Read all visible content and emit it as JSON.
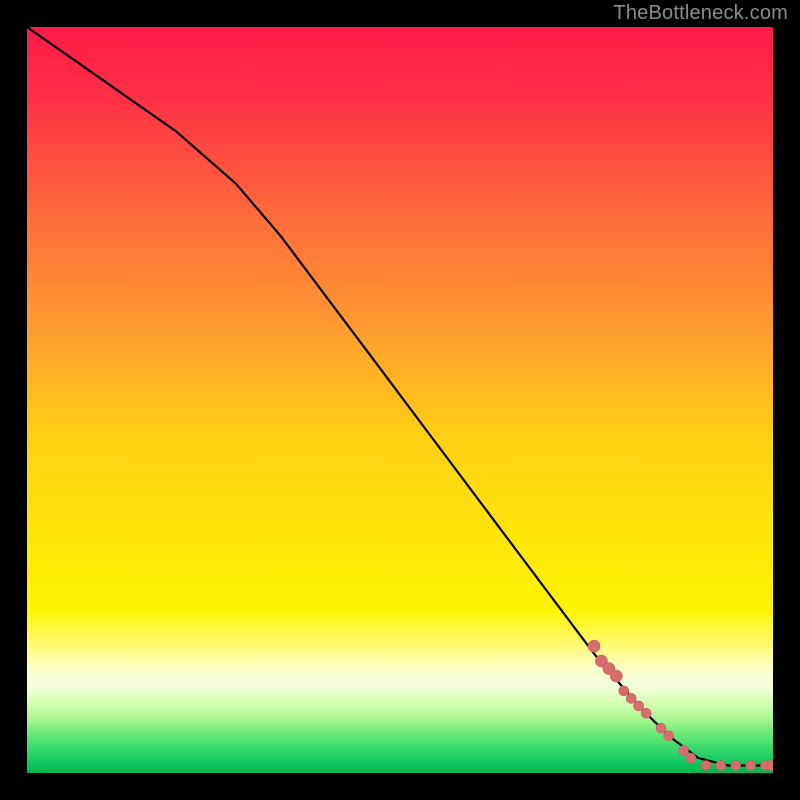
{
  "watermark": "TheBottleneck.com",
  "colors": {
    "point_fill": "#d76e6e",
    "point_stroke": "#c85b5b",
    "curve": "#000000"
  },
  "chart_data": {
    "type": "line+scatter",
    "title": "",
    "xlabel": "",
    "ylabel": "",
    "xlim": [
      0,
      100
    ],
    "ylim": [
      0,
      100
    ],
    "curve": [
      {
        "x": 0,
        "y": 100
      },
      {
        "x": 10,
        "y": 93
      },
      {
        "x": 20,
        "y": 86
      },
      {
        "x": 28,
        "y": 79
      },
      {
        "x": 34,
        "y": 72
      },
      {
        "x": 40,
        "y": 64
      },
      {
        "x": 46,
        "y": 56
      },
      {
        "x": 52,
        "y": 48
      },
      {
        "x": 58,
        "y": 40
      },
      {
        "x": 64,
        "y": 32
      },
      {
        "x": 70,
        "y": 24
      },
      {
        "x": 76,
        "y": 16
      },
      {
        "x": 82,
        "y": 9
      },
      {
        "x": 86,
        "y": 5
      },
      {
        "x": 90,
        "y": 2
      },
      {
        "x": 94,
        "y": 1
      },
      {
        "x": 98,
        "y": 1
      },
      {
        "x": 100,
        "y": 1
      }
    ],
    "points": [
      {
        "x": 76,
        "y": 17,
        "r": 6
      },
      {
        "x": 77,
        "y": 15,
        "r": 6
      },
      {
        "x": 78,
        "y": 14,
        "r": 6
      },
      {
        "x": 79,
        "y": 13,
        "r": 6
      },
      {
        "x": 80,
        "y": 11,
        "r": 5
      },
      {
        "x": 81,
        "y": 10,
        "r": 5
      },
      {
        "x": 82,
        "y": 9,
        "r": 5
      },
      {
        "x": 83,
        "y": 8,
        "r": 5
      },
      {
        "x": 85,
        "y": 6,
        "r": 5
      },
      {
        "x": 86,
        "y": 5,
        "r": 5
      },
      {
        "x": 88,
        "y": 3,
        "r": 5
      },
      {
        "x": 89,
        "y": 2,
        "r": 5
      },
      {
        "x": 91,
        "y": 1,
        "r": 5
      },
      {
        "x": 93,
        "y": 1,
        "r": 5
      },
      {
        "x": 95,
        "y": 1,
        "r": 5
      },
      {
        "x": 97,
        "y": 1,
        "r": 5
      },
      {
        "x": 99,
        "y": 1,
        "r": 5
      },
      {
        "x": 100,
        "y": 1,
        "r": 6
      }
    ]
  }
}
